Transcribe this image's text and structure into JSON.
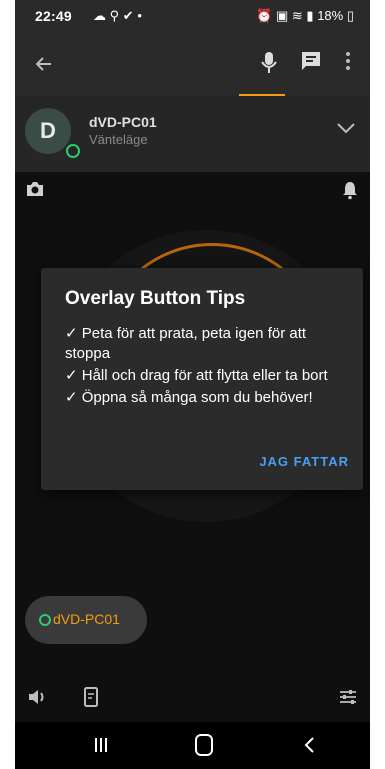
{
  "status_bar": {
    "time": "22:49",
    "battery": "18%"
  },
  "device": {
    "initial": "D",
    "name": "dVD-PC01",
    "status": "Vänteläge"
  },
  "dialog": {
    "title": "Overlay Button Tips",
    "tips": [
      "✓ Peta för att prata, peta igen för att stoppa",
      "✓ Håll och drag för att flytta eller ta bort",
      "✓ Öppna så många som du behöver!"
    ],
    "button": "JAG FATTAR"
  },
  "active_device_pill": {
    "label": "dVD-PC01"
  },
  "colors": {
    "accent": "#f39c12",
    "online": "#2ecc71",
    "link": "#4a9ff5",
    "background": "#0f0f0f",
    "dialog": "#2b2b2b"
  },
  "icons": [
    "cloud-icon",
    "location-icon",
    "check-circle-icon",
    "alarm-icon",
    "battery-saver-icon",
    "wifi-icon",
    "signal-icon",
    "battery-icon",
    "back-arrow-icon",
    "mic-icon",
    "chat-icon",
    "more-vert-icon",
    "chevron-down-icon",
    "camera-icon",
    "bell-icon",
    "volume-icon",
    "phone-device-icon",
    "tune-icon",
    "nav-recents-icon",
    "nav-home-icon",
    "nav-back-icon"
  ]
}
